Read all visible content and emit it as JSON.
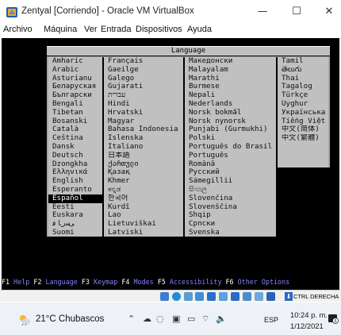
{
  "window": {
    "title": "Zentyal [Corriendo] - Oracle VM VirtualBox",
    "minimize": "—",
    "maximize": "☐",
    "close": "✕"
  },
  "menu": [
    "Archivo",
    "Máquina",
    "Ver",
    "Entrada",
    "Dispositivos",
    "Ayuda"
  ],
  "installer": {
    "header": "Language",
    "columns": [
      [
        "Amharic",
        "Arabic",
        "Asturianu",
        "Беларуская",
        "Български",
        "Bengali",
        "Tibetan",
        "Bosanski",
        "Català",
        "Čeština",
        "Dansk",
        "Deutsch",
        "Dzongkha",
        "Ελληνικά",
        "English",
        "Esperanto",
        "Español",
        "Eesti",
        "Euskara",
        "ﻰﺳﺭﺎﻓ",
        "Suomi"
      ],
      [
        "Français",
        "Gaeilge",
        "Galego",
        "Gujarati",
        "עברית",
        "Hindi",
        "Hrvatski",
        "Magyar",
        "Bahasa Indonesia",
        "Íslenska",
        "Italiano",
        "日本語",
        "ქართული",
        "Қазақ",
        "Khmer",
        "ಕನ್ನಡ",
        "한국어",
        "Kurdî",
        "Lao",
        "Lietuviškai",
        "Latviski"
      ],
      [
        "Македонски",
        "Malayalam",
        "Marathi",
        "Burmese",
        "Nepali",
        "Nederlands",
        "Norsk bokmål",
        "Norsk nynorsk",
        "Punjabi (Gurmukhi)",
        "Polski",
        "Português do Brasil",
        "Português",
        "Română",
        "Русский",
        "Sámegillii",
        "සිංහල",
        "Slovenčina",
        "Slovenščina",
        "Shqip",
        "Српски",
        "Svenska"
      ],
      [
        "Tamil",
        "తెలుగు",
        "Thai",
        "Tagalog",
        "Türkçe",
        "Uyghur",
        "Українська",
        "Tiếng Việt",
        "中文(简体)",
        "中文(繁體)"
      ]
    ],
    "selected": "Español",
    "fkeys": [
      {
        "key": "F1",
        "label": "Help"
      },
      {
        "key": "F2",
        "label": "Language"
      },
      {
        "key": "F3",
        "label": "Keymap"
      },
      {
        "key": "F4",
        "label": "Modes"
      },
      {
        "key": "F5",
        "label": "Accessibility"
      },
      {
        "key": "F6",
        "label": "Other Options"
      }
    ]
  },
  "statusbar": {
    "host_key": "CTRL DERECHA",
    "icons": [
      "hard-disk-icon",
      "optical-drive-icon",
      "audio-icon",
      "network-icon",
      "usb-icon",
      "shared-folders-icon",
      "display-icon",
      "video-capture-icon",
      "cpu-icon",
      "mouse-integration-icon"
    ]
  },
  "taskbar": {
    "weather": "21°C Chubascos",
    "input_lang": "ESP",
    "time": "10:24 p. m.",
    "date": "1/12/2021",
    "notification_count": "5",
    "tray_icons": [
      "chevron-up-icon",
      "onedrive-icon",
      "chat-icon",
      "photos-icon",
      "battery-icon",
      "wifi-icon",
      "volume-icon"
    ]
  },
  "colors": {
    "vm_background": "#000000",
    "dialog_gray": "#c0c0c0",
    "fkey_label": "#8080ff",
    "selection": "#000000"
  }
}
